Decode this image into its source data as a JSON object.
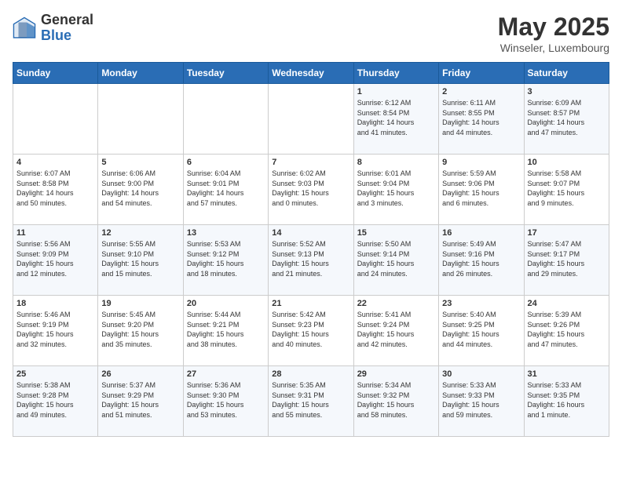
{
  "header": {
    "logo_general": "General",
    "logo_blue": "Blue",
    "title": "May 2025",
    "subtitle": "Winseler, Luxembourg"
  },
  "days_of_week": [
    "Sunday",
    "Monday",
    "Tuesday",
    "Wednesday",
    "Thursday",
    "Friday",
    "Saturday"
  ],
  "weeks": [
    [
      {
        "day": "",
        "info": ""
      },
      {
        "day": "",
        "info": ""
      },
      {
        "day": "",
        "info": ""
      },
      {
        "day": "",
        "info": ""
      },
      {
        "day": "1",
        "info": "Sunrise: 6:12 AM\nSunset: 8:54 PM\nDaylight: 14 hours\nand 41 minutes."
      },
      {
        "day": "2",
        "info": "Sunrise: 6:11 AM\nSunset: 8:55 PM\nDaylight: 14 hours\nand 44 minutes."
      },
      {
        "day": "3",
        "info": "Sunrise: 6:09 AM\nSunset: 8:57 PM\nDaylight: 14 hours\nand 47 minutes."
      }
    ],
    [
      {
        "day": "4",
        "info": "Sunrise: 6:07 AM\nSunset: 8:58 PM\nDaylight: 14 hours\nand 50 minutes."
      },
      {
        "day": "5",
        "info": "Sunrise: 6:06 AM\nSunset: 9:00 PM\nDaylight: 14 hours\nand 54 minutes."
      },
      {
        "day": "6",
        "info": "Sunrise: 6:04 AM\nSunset: 9:01 PM\nDaylight: 14 hours\nand 57 minutes."
      },
      {
        "day": "7",
        "info": "Sunrise: 6:02 AM\nSunset: 9:03 PM\nDaylight: 15 hours\nand 0 minutes."
      },
      {
        "day": "8",
        "info": "Sunrise: 6:01 AM\nSunset: 9:04 PM\nDaylight: 15 hours\nand 3 minutes."
      },
      {
        "day": "9",
        "info": "Sunrise: 5:59 AM\nSunset: 9:06 PM\nDaylight: 15 hours\nand 6 minutes."
      },
      {
        "day": "10",
        "info": "Sunrise: 5:58 AM\nSunset: 9:07 PM\nDaylight: 15 hours\nand 9 minutes."
      }
    ],
    [
      {
        "day": "11",
        "info": "Sunrise: 5:56 AM\nSunset: 9:09 PM\nDaylight: 15 hours\nand 12 minutes."
      },
      {
        "day": "12",
        "info": "Sunrise: 5:55 AM\nSunset: 9:10 PM\nDaylight: 15 hours\nand 15 minutes."
      },
      {
        "day": "13",
        "info": "Sunrise: 5:53 AM\nSunset: 9:12 PM\nDaylight: 15 hours\nand 18 minutes."
      },
      {
        "day": "14",
        "info": "Sunrise: 5:52 AM\nSunset: 9:13 PM\nDaylight: 15 hours\nand 21 minutes."
      },
      {
        "day": "15",
        "info": "Sunrise: 5:50 AM\nSunset: 9:14 PM\nDaylight: 15 hours\nand 24 minutes."
      },
      {
        "day": "16",
        "info": "Sunrise: 5:49 AM\nSunset: 9:16 PM\nDaylight: 15 hours\nand 26 minutes."
      },
      {
        "day": "17",
        "info": "Sunrise: 5:47 AM\nSunset: 9:17 PM\nDaylight: 15 hours\nand 29 minutes."
      }
    ],
    [
      {
        "day": "18",
        "info": "Sunrise: 5:46 AM\nSunset: 9:19 PM\nDaylight: 15 hours\nand 32 minutes."
      },
      {
        "day": "19",
        "info": "Sunrise: 5:45 AM\nSunset: 9:20 PM\nDaylight: 15 hours\nand 35 minutes."
      },
      {
        "day": "20",
        "info": "Sunrise: 5:44 AM\nSunset: 9:21 PM\nDaylight: 15 hours\nand 38 minutes."
      },
      {
        "day": "21",
        "info": "Sunrise: 5:42 AM\nSunset: 9:23 PM\nDaylight: 15 hours\nand 40 minutes."
      },
      {
        "day": "22",
        "info": "Sunrise: 5:41 AM\nSunset: 9:24 PM\nDaylight: 15 hours\nand 42 minutes."
      },
      {
        "day": "23",
        "info": "Sunrise: 5:40 AM\nSunset: 9:25 PM\nDaylight: 15 hours\nand 44 minutes."
      },
      {
        "day": "24",
        "info": "Sunrise: 5:39 AM\nSunset: 9:26 PM\nDaylight: 15 hours\nand 47 minutes."
      }
    ],
    [
      {
        "day": "25",
        "info": "Sunrise: 5:38 AM\nSunset: 9:28 PM\nDaylight: 15 hours\nand 49 minutes."
      },
      {
        "day": "26",
        "info": "Sunrise: 5:37 AM\nSunset: 9:29 PM\nDaylight: 15 hours\nand 51 minutes."
      },
      {
        "day": "27",
        "info": "Sunrise: 5:36 AM\nSunset: 9:30 PM\nDaylight: 15 hours\nand 53 minutes."
      },
      {
        "day": "28",
        "info": "Sunrise: 5:35 AM\nSunset: 9:31 PM\nDaylight: 15 hours\nand 55 minutes."
      },
      {
        "day": "29",
        "info": "Sunrise: 5:34 AM\nSunset: 9:32 PM\nDaylight: 15 hours\nand 58 minutes."
      },
      {
        "day": "30",
        "info": "Sunrise: 5:33 AM\nSunset: 9:33 PM\nDaylight: 15 hours\nand 59 minutes."
      },
      {
        "day": "31",
        "info": "Sunrise: 5:33 AM\nSunset: 9:35 PM\nDaylight: 16 hours\nand 1 minute."
      }
    ]
  ]
}
